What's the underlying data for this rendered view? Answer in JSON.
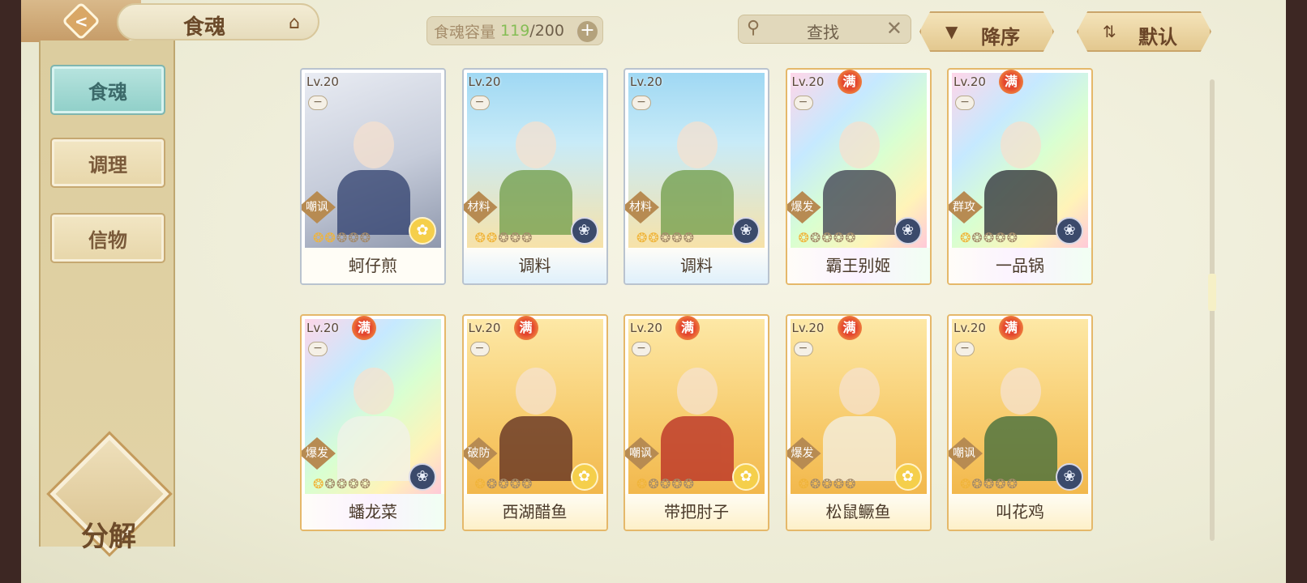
{
  "header": {
    "title": "食魂",
    "capacity_label": "食魂容量",
    "capacity_count": "119",
    "capacity_sep": "/",
    "capacity_max": "200",
    "search_placeholder": "查找",
    "sort_order_label": "降序",
    "sort_mode_label": "默认"
  },
  "sidebar": {
    "items": [
      {
        "label": "食魂",
        "active": true
      },
      {
        "label": "调理",
        "active": false
      },
      {
        "label": "信物",
        "active": false
      }
    ],
    "decompose_label": "分解"
  },
  "cards": [
    {
      "level": "Lv.20",
      "full": "",
      "role": "嘲讽",
      "stars": 2,
      "element": "gold",
      "name": "蚵仔煎",
      "frame": "silver"
    },
    {
      "level": "Lv.20",
      "full": "",
      "role": "材料",
      "stars": 2,
      "element": "blue",
      "name": "调料",
      "frame": "blue"
    },
    {
      "level": "Lv.20",
      "full": "",
      "role": "材料",
      "stars": 2,
      "element": "blue",
      "name": "调料",
      "frame": "blue"
    },
    {
      "level": "Lv.20",
      "full": "满",
      "role": "爆发",
      "stars": 1,
      "element": "blue",
      "name": "霸王别姬",
      "frame": "rainbow"
    },
    {
      "level": "Lv.20",
      "full": "满",
      "role": "群攻",
      "stars": 1,
      "element": "blue",
      "name": "一品锅",
      "frame": "rainbow"
    },
    {
      "level": "Lv.20",
      "full": "满",
      "role": "爆发",
      "stars": 1,
      "element": "blue",
      "name": "蟠龙菜",
      "frame": "rainbow"
    },
    {
      "level": "Lv.20",
      "full": "满",
      "role": "破防",
      "stars": 1,
      "element": "gold",
      "name": "西湖醋鱼",
      "frame": "gold"
    },
    {
      "level": "Lv.20",
      "full": "满",
      "role": "嘲讽",
      "stars": 1,
      "element": "gold",
      "name": "带把肘子",
      "frame": "gold"
    },
    {
      "level": "Lv.20",
      "full": "满",
      "role": "爆发",
      "stars": 1,
      "element": "gold",
      "name": "松鼠鳜鱼",
      "frame": "gold"
    },
    {
      "level": "Lv.20",
      "full": "满",
      "role": "嘲讽",
      "stars": 1,
      "element": "blue",
      "name": "叫花鸡",
      "frame": "gold"
    }
  ],
  "icons": {
    "back": "back-arrow-icon",
    "home": "pagoda-icon",
    "search": "magnifier-icon",
    "clear": "close-icon",
    "sort_order": "triangle-down-icon",
    "sort_mode": "sort-arrows-icon",
    "add": "plus-icon"
  },
  "colors": {
    "accent": "#85bd55",
    "active_tab": "#8fcfc8",
    "full_badge": "#e4462e"
  }
}
